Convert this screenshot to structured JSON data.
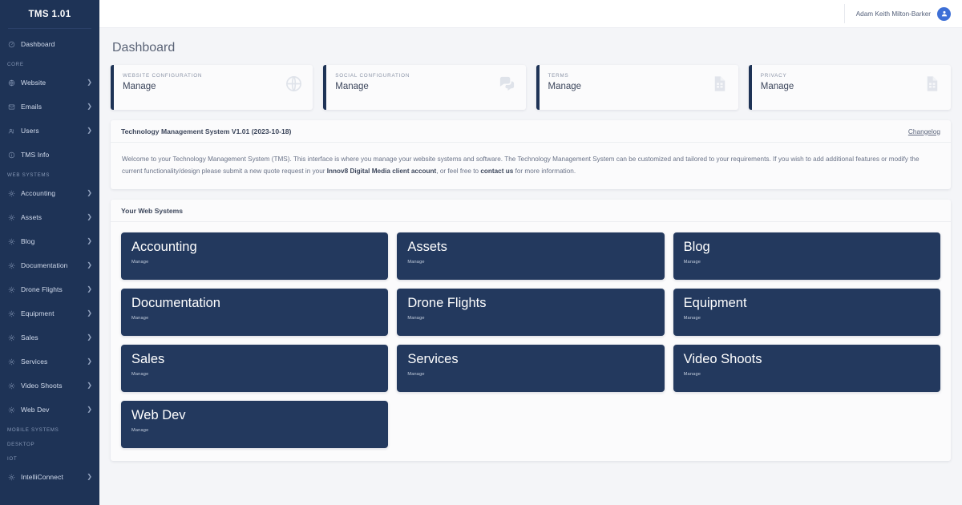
{
  "sidebar": {
    "brand": "TMS 1.01",
    "groups": [
      {
        "label": null,
        "items": [
          {
            "label": "Dashboard",
            "icon": "gauge-icon",
            "caret": false
          }
        ]
      },
      {
        "label": "CORE",
        "items": [
          {
            "label": "Website",
            "icon": "globe-icon",
            "caret": true
          },
          {
            "label": "Emails",
            "icon": "envelope-icon",
            "caret": true
          },
          {
            "label": "Users",
            "icon": "users-icon",
            "caret": true
          },
          {
            "label": "TMS Info",
            "icon": "info-icon",
            "caret": false
          }
        ]
      },
      {
        "label": "WEB SYSTEMS",
        "items": [
          {
            "label": "Accounting",
            "icon": "gear-icon",
            "caret": true
          },
          {
            "label": "Assets",
            "icon": "gear-icon",
            "caret": true
          },
          {
            "label": "Blog",
            "icon": "gear-icon",
            "caret": true
          },
          {
            "label": "Documentation",
            "icon": "gear-icon",
            "caret": true
          },
          {
            "label": "Drone Flights",
            "icon": "gear-icon",
            "caret": true
          },
          {
            "label": "Equipment",
            "icon": "gear-icon",
            "caret": true
          },
          {
            "label": "Sales",
            "icon": "gear-icon",
            "caret": true
          },
          {
            "label": "Services",
            "icon": "gear-icon",
            "caret": true
          },
          {
            "label": "Video Shoots",
            "icon": "gear-icon",
            "caret": true
          },
          {
            "label": "Web Dev",
            "icon": "gear-icon",
            "caret": true
          }
        ]
      },
      {
        "label": "MOBILE SYSTEMS",
        "items": []
      },
      {
        "label": "DESKTOP",
        "items": []
      },
      {
        "label": "IOT",
        "items": [
          {
            "label": "IntelliConnect",
            "icon": "gear-icon",
            "caret": true
          }
        ]
      }
    ]
  },
  "topbar": {
    "user_name": "Adam Keith Milton-Barker",
    "avatar_icon": "user-icon"
  },
  "page": {
    "title": "Dashboard"
  },
  "cards": [
    {
      "kicker": "WEBSITE CONFIGURATION",
      "value": "Manage",
      "icon": "globe-icon"
    },
    {
      "kicker": "SOCIAL CONFIGURATION",
      "value": "Manage",
      "icon": "chat-bubbles-icon"
    },
    {
      "kicker": "TERMS",
      "value": "Manage",
      "icon": "document-icon"
    },
    {
      "kicker": "PRIVACY",
      "value": "Manage",
      "icon": "document-icon"
    }
  ],
  "welcome": {
    "title": "Technology Management System V1.01 (2023-10-18)",
    "link": "Changelog",
    "text_part1": "Welcome to your Technology Management System (TMS). This interface is where you manage your website systems and software. The Technology Management System can be customized and tailored to your requirements. If you wish to add additional features or modify the current functionality/design please submit a new quote request in your ",
    "link1": "Innov8 Digital Media client account",
    "text_part2": ", or feel free to ",
    "link2": "contact us",
    "text_part3": " for more information."
  },
  "systems": {
    "title": "Your Web Systems",
    "tiles": [
      {
        "name": "Accounting",
        "sub": "Manage"
      },
      {
        "name": "Assets",
        "sub": "Manage"
      },
      {
        "name": "Blog",
        "sub": "Manage"
      },
      {
        "name": "Documentation",
        "sub": "Manage"
      },
      {
        "name": "Drone Flights",
        "sub": "Manage"
      },
      {
        "name": "Equipment",
        "sub": "Manage"
      },
      {
        "name": "Sales",
        "sub": "Manage"
      },
      {
        "name": "Services",
        "sub": "Manage"
      },
      {
        "name": "Video Shoots",
        "sub": "Manage"
      },
      {
        "name": "Web Dev",
        "sub": "Manage"
      }
    ]
  },
  "colors": {
    "sidebar_bg": "#1e3356",
    "tile_bg": "#23395e",
    "accent_bar": "#1e3356",
    "avatar_bg": "#3d6fd6",
    "page_bg": "#f4f5f8"
  }
}
